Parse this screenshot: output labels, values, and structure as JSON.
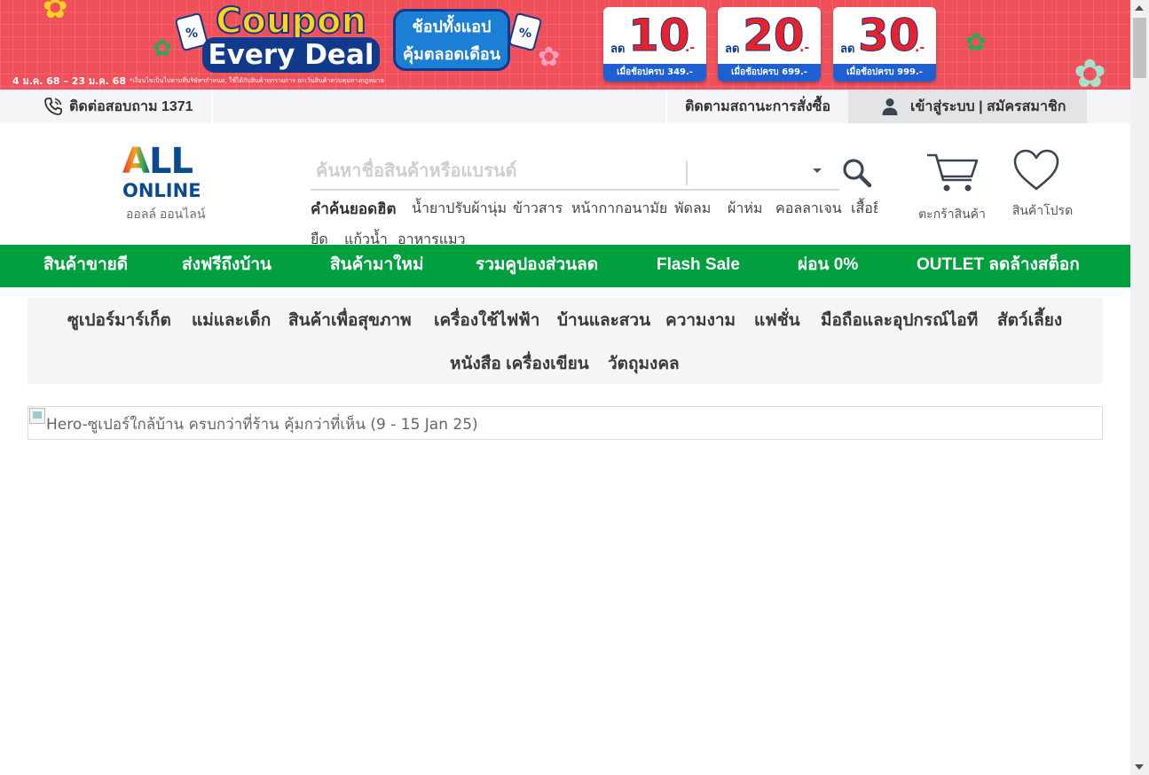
{
  "promo_banner": {
    "coupon_word": "Coupon",
    "every_deal": "Every Deal",
    "app_badge_line1": "ช้อปทั้งแอป",
    "app_badge_line2": "คุ้มตลอดเดือน",
    "date_range": "4 ม.ค. 68 – 23 ม.ค. 68",
    "fine_print": "*เงื่อนไขเป็นไปตามที่บริษัทฯกำหนด, ใช้ได้กับสินค้าทุกรายการ ยกเว้นสินค้าควบคุมทางกฎหมาย",
    "deals": [
      {
        "prefix": "ลด",
        "amount": "10",
        "suffix": ".-",
        "condition": "เมื่อช้อปครบ 349.-"
      },
      {
        "prefix": "ลด",
        "amount": "20",
        "suffix": ".-",
        "condition": "เมื่อช้อปครบ 699.-"
      },
      {
        "prefix": "ลด",
        "amount": "30",
        "suffix": ".-",
        "condition": "เมื่อช้อปครบ 999.-"
      }
    ]
  },
  "utility_bar": {
    "contact": "ติดต่อสอบถาม 1371",
    "track_order": "ติดตามสถานะการสั่งซื้อ",
    "login_register": "เข้าสู่ระบบ | สมัครสมาชิก"
  },
  "logo": {
    "brand_all": "ALL",
    "brand_online": "ONLINE",
    "brand_thai": "ออลล์ ออนไลน์"
  },
  "search": {
    "placeholder": "ค้นหาชื่อสินค้าหรือแบรนด์",
    "value": "",
    "category_selected": ""
  },
  "hot_searches": {
    "label": "คำค้นยอดฮิต",
    "items": [
      "น้ำยาปรับผ้านุ่ม",
      "ข้าวสาร",
      "หน้ากากอนามัย",
      "พัดลม",
      "ผ้าห่ม",
      "คอลลาเจน",
      "เสื้อยืด",
      "แก้วน้ำ",
      "อาหารแมว"
    ]
  },
  "header_actions": {
    "cart_label": "ตะกร้าสินค้า",
    "favorites_label": "สินค้าโปรด"
  },
  "green_nav": [
    "สินค้าขายดี",
    "ส่งฟรีถึงบ้าน",
    "สินค้ามาใหม่",
    "รวมคูปองส่วนลด",
    "Flash Sale",
    "ผ่อน 0%",
    "OUTLET ลดล้างสต็อก"
  ],
  "categories": [
    "ซูเปอร์มาร์เก็ต",
    "แม่และเด็ก",
    "สินค้าเพื่อสุขภาพ",
    "เครื่องใช้ไฟฟ้า",
    "บ้านและสวน",
    "ความงาม",
    "แฟชั่น",
    "มือถือและอุปกรณ์ไอที",
    "สัตว์เลี้ยง",
    "หนังสือ เครื่องเขียน",
    "วัตถุมงคล"
  ],
  "hero": {
    "alt_text": "Hero-ซูเปอร์ใกล้บ้าน ครบกว่าที่ร้าน คุ้มกว่าที่เห็น (9 - 15 Jan 25)"
  },
  "colors": {
    "brand_green": "#00a03e",
    "brand_blue": "#0a4a8f",
    "brand_red": "#e6332a",
    "promo_red": "#f0505a"
  }
}
